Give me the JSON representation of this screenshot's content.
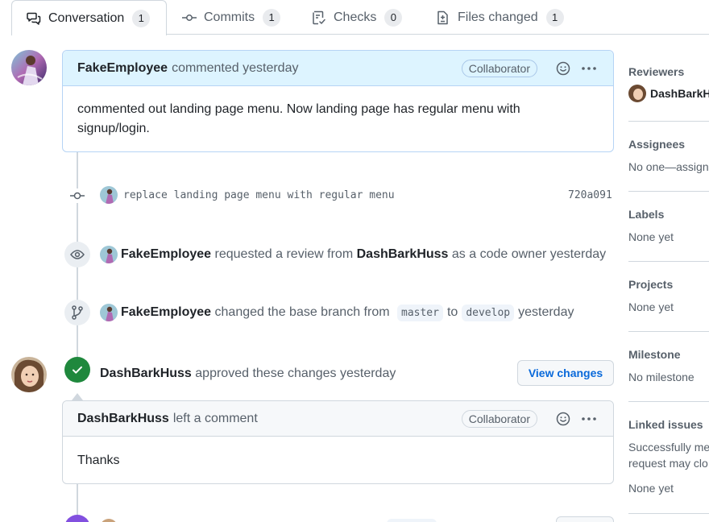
{
  "tabs": [
    {
      "label": "Conversation",
      "count": "1",
      "icon": "comment-discussion-icon"
    },
    {
      "label": "Commits",
      "count": "1",
      "icon": "git-commit-icon"
    },
    {
      "label": "Checks",
      "count": "0",
      "icon": "checklist-icon"
    },
    {
      "label": "Files changed",
      "count": "1",
      "icon": "file-diff-icon"
    }
  ],
  "comment1": {
    "author": "FakeEmployee",
    "action": "commented yesterday",
    "badge": "Collaborator",
    "body": "commented out landing page menu. Now landing page has regular menu with signup/login."
  },
  "commit": {
    "message": "replace landing page menu with regular menu",
    "sha": "720a091"
  },
  "review_request": {
    "actor": "FakeEmployee",
    "text1": "requested a review from",
    "reviewer": "DashBarkHuss",
    "text2": "as a code owner yesterday"
  },
  "base_change": {
    "actor": "FakeEmployee",
    "text1": "changed the base branch from",
    "from": "master",
    "text2": "to",
    "to": "develop",
    "text3": "yesterday"
  },
  "approval": {
    "actor": "DashBarkHuss",
    "text": "approved these changes yesterday",
    "button": "View changes"
  },
  "comment2": {
    "author": "DashBarkHuss",
    "action": "left a comment",
    "badge": "Collaborator",
    "body": "Thanks"
  },
  "sidebar": {
    "reviewers": {
      "title": "Reviewers",
      "value": "DashBarkH"
    },
    "assignees": {
      "title": "Assignees",
      "value": "No one—assign"
    },
    "labels": {
      "title": "Labels",
      "value": "None yet"
    },
    "projects": {
      "title": "Projects",
      "value": "None yet"
    },
    "milestone": {
      "title": "Milestone",
      "value": "No milestone"
    },
    "linked_issues": {
      "title": "Linked issues",
      "line1": "Successfully me",
      "line2": "request may clo",
      "value": "None yet"
    }
  },
  "colors": {
    "accent": "#0969da",
    "success": "#1f883d",
    "merged": "#8250df",
    "comment_header": "#ddf4ff"
  }
}
